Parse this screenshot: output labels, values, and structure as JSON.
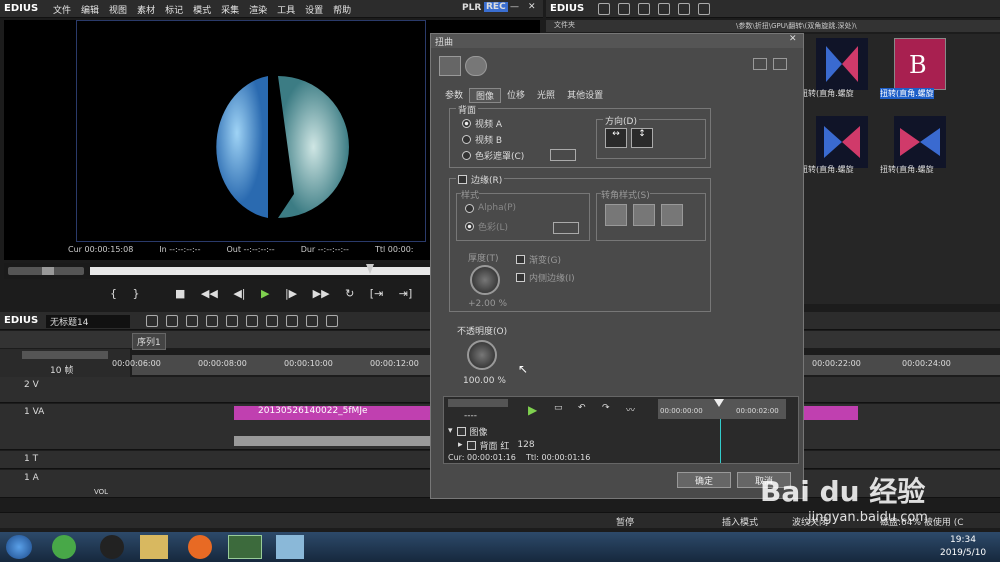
{
  "app": {
    "name": "EDIUS",
    "menu": [
      "文件",
      "编辑",
      "视图",
      "素材",
      "标记",
      "模式",
      "采集",
      "渲染",
      "工具",
      "设置",
      "帮助"
    ],
    "plr": "PLR",
    "rec": "REC"
  },
  "preview": {
    "cur": "Cur 00:00:15:08",
    "in": "In --:--:--:--",
    "out": "Out --:--:--:--",
    "dur": "Dur --:--:--:--",
    "ttl": "Ttl 00:00:"
  },
  "bin": {
    "app": "EDIUS",
    "folder_label": "文件夹",
    "path": "\\参数\\折扭\\GPU\\翻转\\(双角旋跳.深处)\\",
    "items": [
      {
        "label": "扭转(直角.螺旋",
        "selected": false
      },
      {
        "label": "扭转(直角.螺旋",
        "selected": true
      },
      {
        "label": "扭转(直角.螺旋",
        "selected": false
      },
      {
        "label": "扭转(直角.螺旋",
        "selected": false
      }
    ]
  },
  "timeline": {
    "app": "EDIUS",
    "project": "无标题14",
    "sequence_tab": "序列1",
    "zoom": "10 帧",
    "ticks": [
      "00:00:06:00",
      "00:00:08:00",
      "00:00:10:00",
      "00:00:12:00",
      "00:00:22:00",
      "00:00:24:00"
    ],
    "tracks": [
      {
        "name": "2 V"
      },
      {
        "name": "1 VA"
      },
      {
        "name": "1 T"
      },
      {
        "name": "1 A",
        "extra": "VOL"
      }
    ],
    "clip_name": "20130526140022_5fMJe"
  },
  "dialog": {
    "title": "扭曲",
    "tabs": [
      "参数",
      "图像",
      "位移",
      "光照",
      "其他设置"
    ],
    "active_tab": "图像",
    "background": {
      "label": "背面",
      "options": [
        "视频 A",
        "视频 B",
        "色彩遮罩(C)"
      ],
      "selected": 0
    },
    "direction": {
      "label": "方向(D)"
    },
    "border": {
      "label": "边缘(R)",
      "style_label": "样式",
      "style_options": [
        "Alpha(P)",
        "色彩(L)"
      ],
      "corner_label": "转角样式(S)",
      "thickness_label": "厚度(T)",
      "thickness_value": "+2.00 %",
      "gradient": "渐变(G)",
      "inner": "内侧边缘(I)"
    },
    "opacity": {
      "label": "不透明度(O)",
      "value": "100.00 %"
    },
    "keyframes": {
      "tree": [
        {
          "label": "图像"
        },
        {
          "label": "背面 红",
          "value": "128"
        }
      ],
      "cur": "Cur: 00:00:01:16",
      "ttl": "Ttl: 00:00:01:16",
      "ruler": [
        "00:00:00:00",
        "00:00:02:00"
      ],
      "field": "----"
    },
    "ok": "确定",
    "cancel": "取消"
  },
  "status": {
    "items": [
      "暂停",
      "插入模式",
      "波纹关闭",
      "磁盘:64% 被使用 (C"
    ]
  },
  "taskbar": {
    "time": "19:34",
    "date": "2019/5/10"
  },
  "watermark": {
    "text": "Bai du 经验",
    "url": "jingyan.baidu.com"
  }
}
